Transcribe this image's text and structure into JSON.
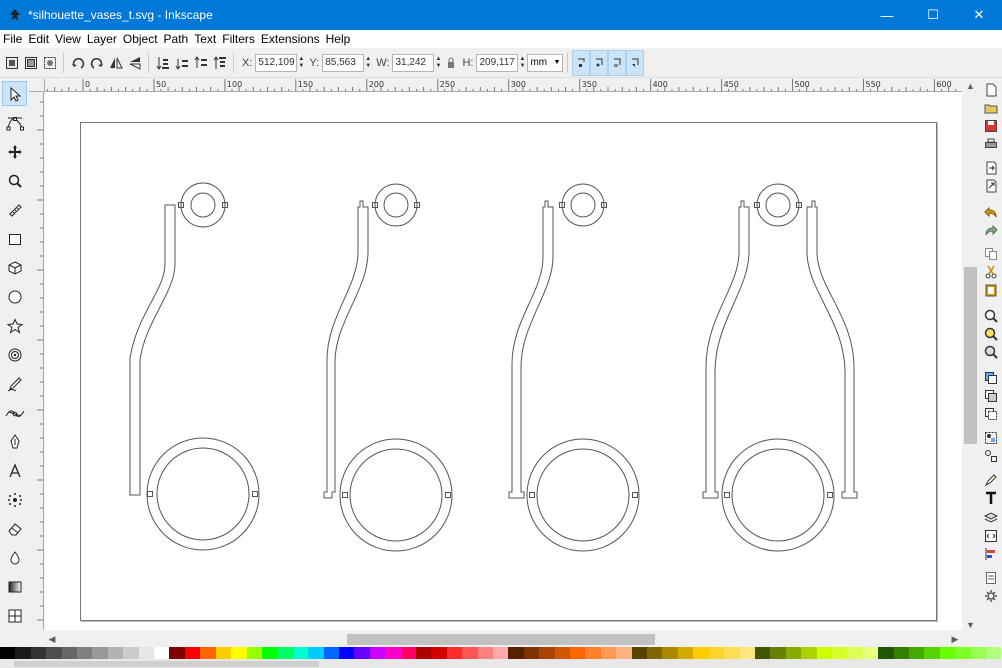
{
  "window": {
    "title": "*silhouette_vases_t.svg - Inkscape",
    "minimize": "—",
    "maximize": "☐",
    "close": "✕"
  },
  "menu": [
    {
      "label": "File",
      "name": "menu-file"
    },
    {
      "label": "Edit",
      "name": "menu-edit"
    },
    {
      "label": "View",
      "name": "menu-view"
    },
    {
      "label": "Layer",
      "name": "menu-layer"
    },
    {
      "label": "Object",
      "name": "menu-object"
    },
    {
      "label": "Path",
      "name": "menu-path"
    },
    {
      "label": "Text",
      "name": "menu-text"
    },
    {
      "label": "Filters",
      "name": "menu-filters"
    },
    {
      "label": "Extensions",
      "name": "menu-extensions"
    },
    {
      "label": "Help",
      "name": "menu-help"
    }
  ],
  "toolcontrols": {
    "x_label": "X:",
    "x_value": "512,109",
    "y_label": "Y:",
    "y_value": "85,563",
    "w_label": "W:",
    "w_value": "31,242",
    "h_label": "H:",
    "h_value": "209,117",
    "unit": "mm"
  },
  "ruler": {
    "labels": [
      "0",
      "50",
      "100",
      "150",
      "200",
      "250",
      "300",
      "350",
      "400",
      "450",
      "500",
      "550",
      "600"
    ]
  },
  "colors": {
    "titlebar": "#0078d7",
    "active_tool": "#cce4f7",
    "canvas": "#ffffff",
    "drawing_stroke": "#555555"
  },
  "tools": [
    {
      "name": "selector-tool-icon",
      "active": true
    },
    {
      "name": "node-tool-icon",
      "active": false
    },
    {
      "name": "tweak-tool-icon",
      "active": false
    },
    {
      "name": "zoom-tool-icon",
      "active": false
    },
    {
      "name": "measure-tool-icon",
      "active": false
    },
    {
      "name": "rectangle-tool-icon",
      "active": false
    },
    {
      "name": "3d-box-tool-icon",
      "active": false
    },
    {
      "name": "ellipse-tool-icon",
      "active": false
    },
    {
      "name": "star-tool-icon",
      "active": false
    },
    {
      "name": "spiral-tool-icon",
      "active": false
    },
    {
      "name": "pencil-tool-icon",
      "active": false
    },
    {
      "name": "bezier-tool-icon",
      "active": false
    },
    {
      "name": "calligraphy-tool-icon",
      "active": false
    },
    {
      "name": "text-tool-icon",
      "active": false
    },
    {
      "name": "spray-tool-icon",
      "active": false
    },
    {
      "name": "eraser-tool-icon",
      "active": false
    },
    {
      "name": "paint-bucket-tool-icon",
      "active": false
    },
    {
      "name": "gradient-tool-icon",
      "active": false
    },
    {
      "name": "mesh-tool-icon",
      "active": false
    }
  ],
  "commands": [
    "new-document-icon",
    "open-icon",
    "save-icon",
    "print-icon",
    "import-icon",
    "export-icon",
    "undo-icon",
    "redo-icon",
    "copy-icon",
    "cut-icon",
    "paste-icon",
    "zoom-selection-icon",
    "zoom-drawing-icon",
    "zoom-page-icon",
    "duplicate-icon",
    "clone-icon",
    "unlink-clone-icon",
    "group-icon",
    "ungroup-icon",
    "fill-stroke-icon",
    "text-font-icon",
    "layers-icon",
    "xml-editor-icon",
    "align-distribute-icon",
    "preferences-icon",
    "document-properties-icon"
  ],
  "palette": [
    "#000000",
    "#1a1a1a",
    "#333333",
    "#4d4d4d",
    "#666666",
    "#808080",
    "#999999",
    "#b3b3b3",
    "#cccccc",
    "#e6e6e6",
    "#ffffff",
    "#800000",
    "#ff0000",
    "#ff6600",
    "#ffcc00",
    "#ffff00",
    "#99ff00",
    "#00ff00",
    "#00ff66",
    "#00ffcc",
    "#00ccff",
    "#0066ff",
    "#0000ff",
    "#6600ff",
    "#cc00ff",
    "#ff00cc",
    "#ff0066",
    "#aa0000",
    "#d40000",
    "#ff2a2a",
    "#ff5555",
    "#ff8080",
    "#ffaaaa",
    "#552200",
    "#803300",
    "#aa4400",
    "#d45500",
    "#ff6600",
    "#ff7f2a",
    "#ff9955",
    "#ffb380",
    "#554400",
    "#806600",
    "#aa8800",
    "#d4aa00",
    "#ffcc00",
    "#ffd42a",
    "#ffdd55",
    "#ffe680",
    "#445500",
    "#668000",
    "#88aa00",
    "#aad400",
    "#ccff00",
    "#d4ff2a",
    "#ddff55",
    "#e5ff80",
    "#225500",
    "#338000",
    "#44aa00",
    "#55d400",
    "#66ff00",
    "#7fff2a",
    "#99ff55",
    "#b3ff80"
  ]
}
